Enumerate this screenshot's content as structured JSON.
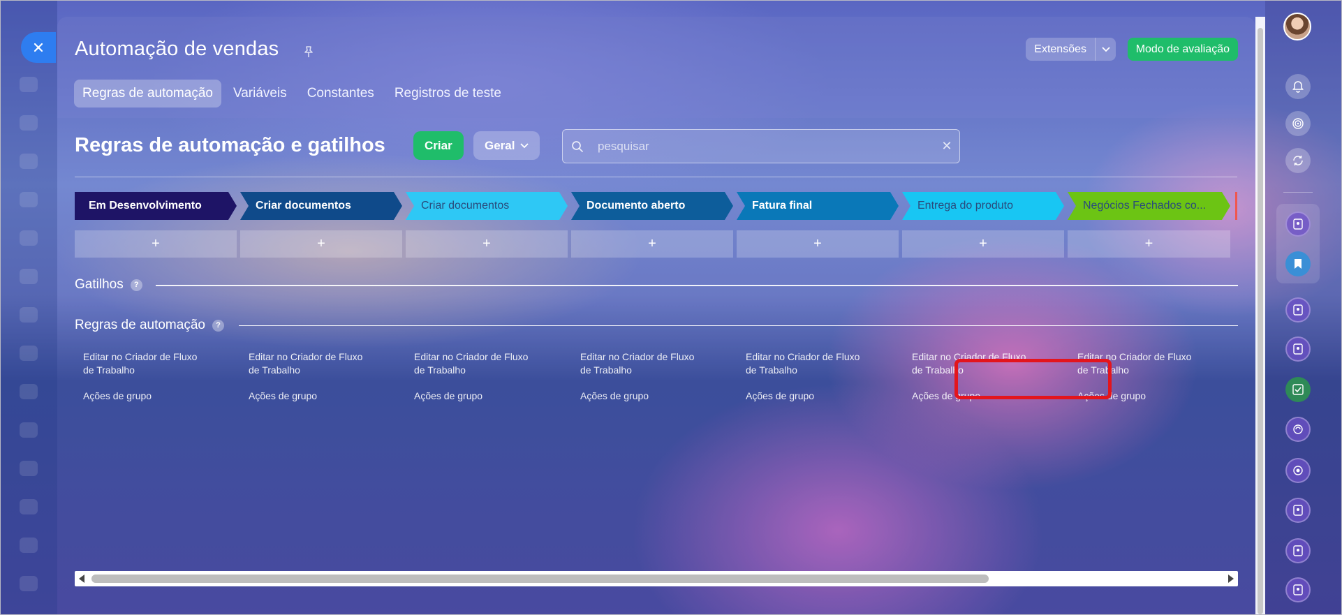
{
  "header": {
    "title": "Automação de vendas",
    "extensions_label": "Extensões",
    "eval_mode_label": "Modo de avaliação",
    "tabs": [
      {
        "label": "Regras de automação",
        "active": true
      },
      {
        "label": "Variáveis",
        "active": false
      },
      {
        "label": "Constantes",
        "active": false
      },
      {
        "label": "Registros de teste",
        "active": false
      }
    ]
  },
  "toolbar": {
    "heading": "Regras de automação e gatilhos",
    "create_label": "Criar",
    "filter_label": "Geral",
    "search_placeholder": "pesquisar"
  },
  "stages": [
    {
      "label": "Em Desenvolvimento",
      "color": "#1e1466"
    },
    {
      "label": "Criar documentos",
      "color": "#0f4a8a"
    },
    {
      "label": "Criar documentos",
      "color": "#2ec8f5"
    },
    {
      "label": "Documento aberto",
      "color": "#0d5d9b"
    },
    {
      "label": "Fatura final",
      "color": "#0a78b8"
    },
    {
      "label": "Entrega do produto",
      "color": "#18c6f3"
    },
    {
      "label": "Negócios Fechados co...",
      "color": "#6cc414"
    }
  ],
  "add_symbol": "+",
  "sections": {
    "triggers": "Gatilhos",
    "rules": "Regras de automação",
    "help": "?"
  },
  "columns": [
    {
      "edit": "Editar no Criador de Fluxo de Trabalho",
      "group": "Ações de grupo"
    },
    {
      "edit": "Editar no Criador de Fluxo de Trabalho",
      "group": "Ações de grupo"
    },
    {
      "edit": "Editar no Criador de Fluxo de Trabalho",
      "group": "Ações de grupo"
    },
    {
      "edit": "Editar no Criador de Fluxo de Trabalho",
      "group": "Ações de grupo"
    },
    {
      "edit": "Editar no Criador de Fluxo de Trabalho",
      "group": "Ações de grupo"
    },
    {
      "edit": "Editar no Criador de Fluxo de Trabalho",
      "group": "Ações de grupo"
    },
    {
      "edit": "Editar no Criador de Fluxo de Trabalho",
      "group": "Ações de grupo"
    }
  ],
  "colors": {
    "accent_green": "#1fbd6a",
    "close_blue": "#2e7df0",
    "highlight_red": "#e3151d"
  },
  "icons": {
    "close": "close-icon",
    "pin": "pin-icon",
    "search": "search-icon",
    "clear": "clear-icon",
    "bell": "bell-icon"
  }
}
